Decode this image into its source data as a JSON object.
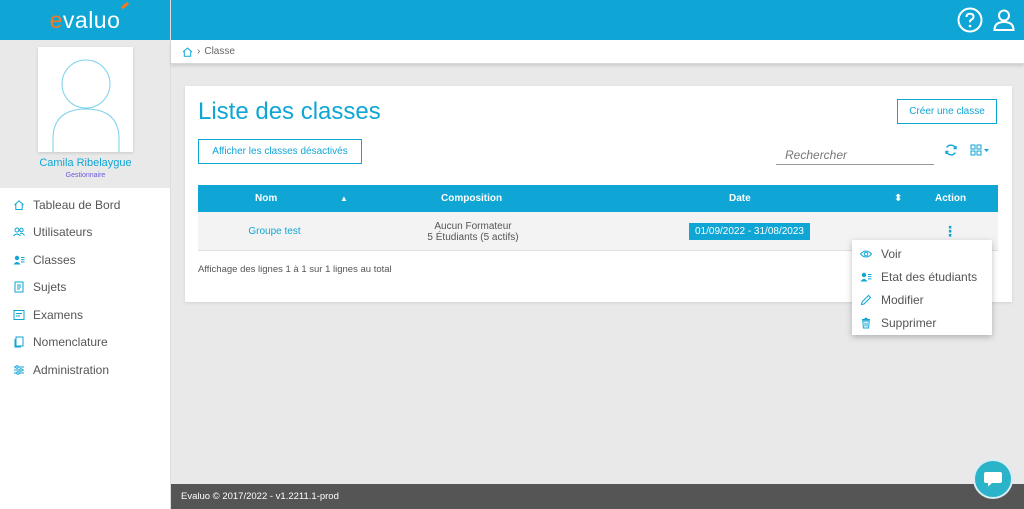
{
  "app": {
    "logo_prefix": "e",
    "logo_rest": "valuo"
  },
  "profile": {
    "name": "Camila Ribelaygue",
    "role": "Gestionnaire"
  },
  "sidebar": {
    "items": [
      {
        "label": "Tableau de Bord",
        "icon": "home-icon"
      },
      {
        "label": "Utilisateurs",
        "icon": "users-icon"
      },
      {
        "label": "Classes",
        "icon": "class-icon"
      },
      {
        "label": "Sujets",
        "icon": "document-icon"
      },
      {
        "label": "Examens",
        "icon": "exam-icon"
      },
      {
        "label": "Nomenclature",
        "icon": "copy-icon"
      },
      {
        "label": "Administration",
        "icon": "sliders-icon"
      }
    ]
  },
  "topbar": {
    "help_icon": "help-icon",
    "user_icon": "user-icon"
  },
  "breadcrumb": {
    "current": "Classe"
  },
  "main": {
    "title": "Liste des classes",
    "create_button": "Créer une classe",
    "show_disabled_button": "Afficher les classes désactivés",
    "search_placeholder": "Rechercher",
    "table": {
      "columns": [
        "Nom",
        "Composition",
        "Date",
        "Action"
      ],
      "sort_up_glyph": "▲",
      "sort_both_glyph": "⬍",
      "rows": [
        {
          "nom": "Groupe test",
          "composition_line1": "Aucun Formateur",
          "composition_line2": "5 Étudiants (5 actifs)",
          "date": "01/09/2022 - 31/08/2023",
          "action": "⋮"
        }
      ]
    },
    "pagination_info": "Affichage des lignes 1 à 1 sur 1 lignes au total"
  },
  "action_menu": {
    "items": [
      {
        "label": "Voir",
        "icon": "eye-icon"
      },
      {
        "label": "Etat des étudiants",
        "icon": "students-icon"
      },
      {
        "label": "Modifier",
        "icon": "pencil-icon"
      },
      {
        "label": "Supprimer",
        "icon": "trash-icon"
      }
    ]
  },
  "footer": {
    "text": "Evaluo © 2017/2022 - v1.2211.1-prod"
  },
  "colors": {
    "primary": "#0fa6d6",
    "logo_accent": "#f47920",
    "footer_bg": "#555555",
    "role": "#6b5bd6"
  }
}
